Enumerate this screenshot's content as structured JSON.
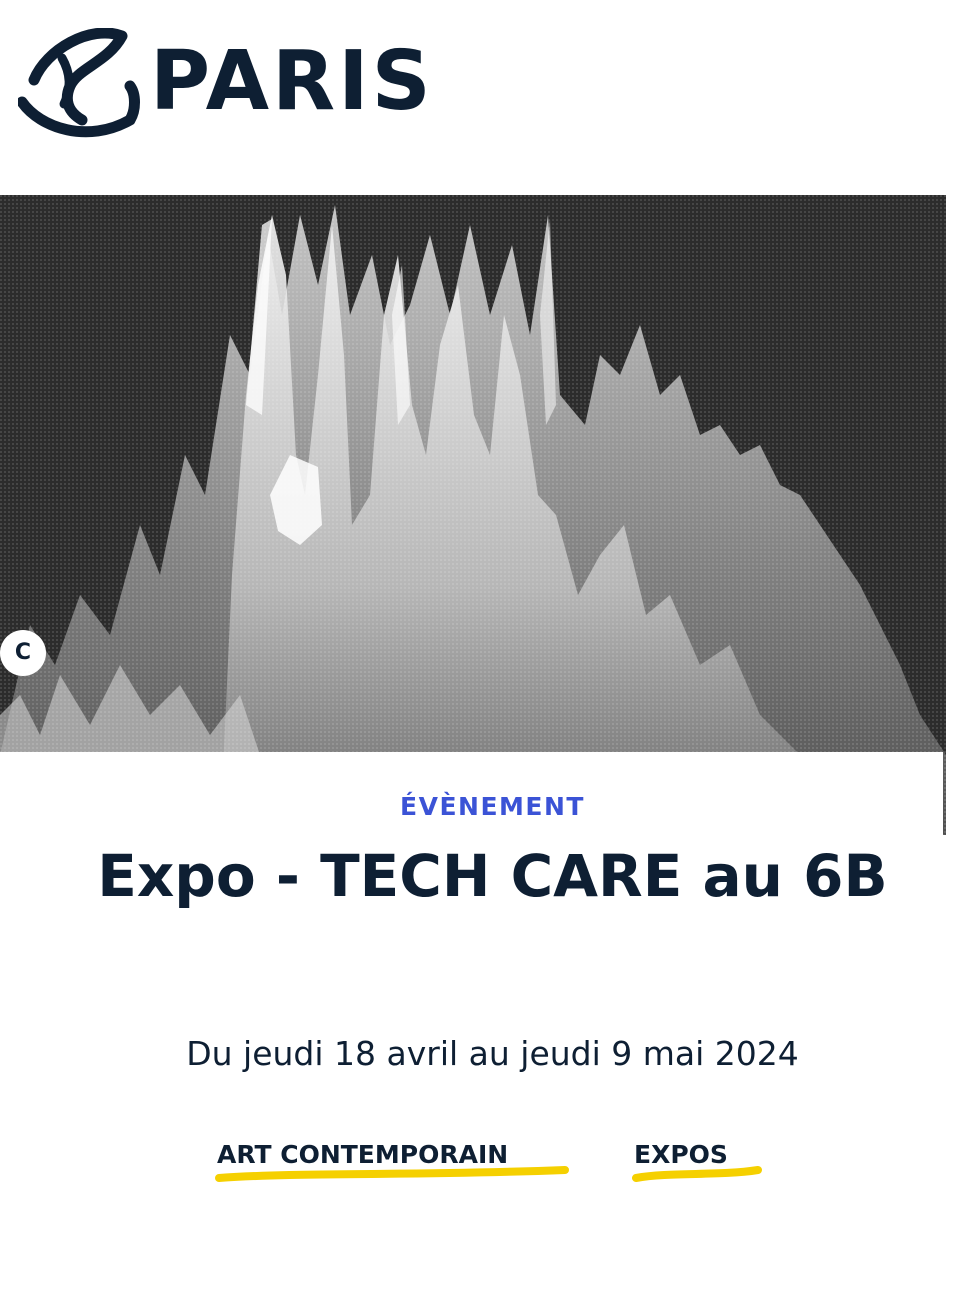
{
  "header": {
    "logo_text": "PARIS",
    "logo_icon": "paris-boat-logo-icon"
  },
  "hero": {
    "image": "tech-care-artwork-image",
    "credit_badge": "C"
  },
  "event": {
    "category": "ÉVÈNEMENT",
    "title": "Expo - TECH CARE au 6B",
    "dates": "Du jeudi 18 avril au jeudi 9 mai 2024"
  },
  "tags": [
    {
      "label": "ART CONTEMPORAIN"
    },
    {
      "label": "EXPOS"
    }
  ],
  "colors": {
    "brand_navy": "#0e1f33",
    "category_blue": "#3b53d6",
    "tag_underline_yellow": "#f5d000",
    "hero_background": "#2c2c2c"
  }
}
